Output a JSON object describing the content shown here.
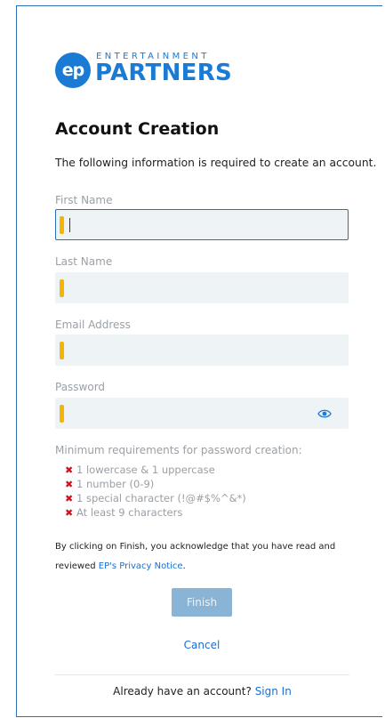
{
  "logo": {
    "badge": "ep",
    "top_text": "ENTERTAINMENT",
    "main_text": "PARTNERS",
    "brand_color": "#1a7ad4"
  },
  "page": {
    "title": "Account Creation",
    "subtitle": "The following information is required to create an account."
  },
  "form": {
    "first_name": {
      "label": "First Name",
      "value": ""
    },
    "last_name": {
      "label": "Last Name",
      "value": ""
    },
    "email": {
      "label": "Email Address",
      "value": ""
    },
    "password": {
      "label": "Password",
      "value": "",
      "toggle_icon": "eye-icon"
    }
  },
  "requirements": {
    "title": "Minimum requirements for password creation:",
    "items": [
      "1 lowercase & 1 uppercase",
      "1 number (0-9)",
      "1 special character (!@#$%^&*)",
      "At least 9 characters"
    ],
    "status_icon": "cross-icon",
    "status_color": "#d0101a"
  },
  "legal": {
    "text": "By clicking on Finish, you acknowledge that you have read and reviewed",
    "link": "EP's Privacy Notice",
    "suffix": "."
  },
  "actions": {
    "finish": "Finish",
    "cancel": "Cancel"
  },
  "footer": {
    "text": "Already have an account?",
    "link": "Sign In"
  },
  "colors": {
    "required_marker": "#f5b400",
    "field_bg": "#eef3f5",
    "link": "#1a6fd0",
    "finish_bg": "#8ab4d5"
  }
}
